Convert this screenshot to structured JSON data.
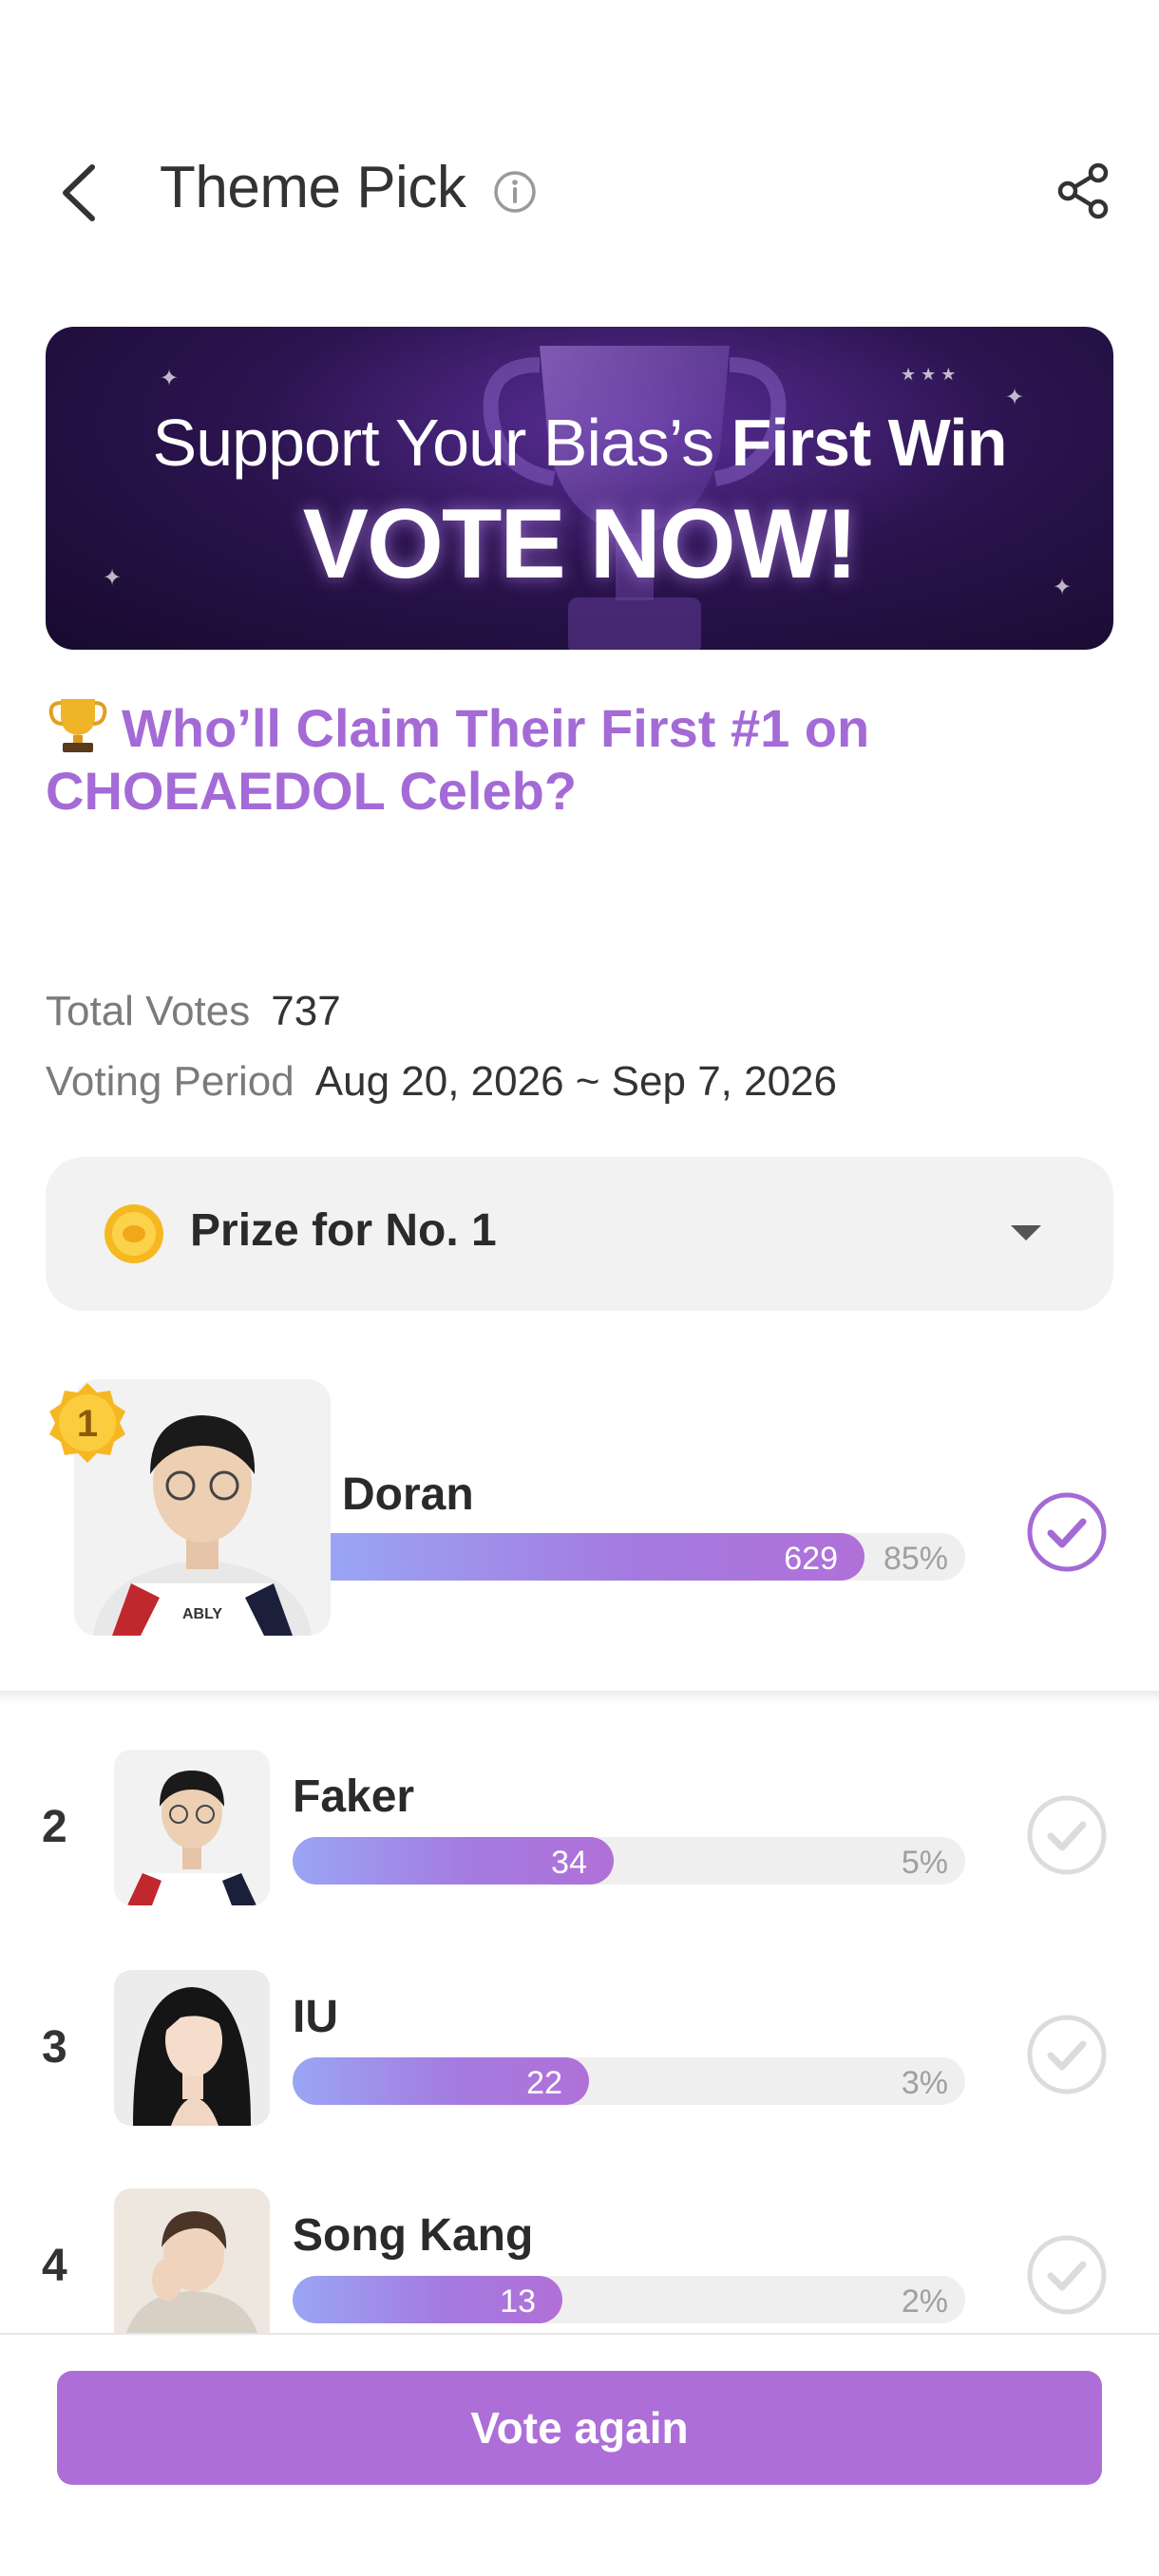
{
  "header": {
    "title": "Theme Pick",
    "back_icon": "chevron-left-icon",
    "info_icon": "info-icon",
    "share_icon": "share-icon"
  },
  "banner": {
    "line1_regular": "Support Your Bias’s",
    "line1_bold": "First Win",
    "line2": "VOTE NOW!"
  },
  "headline": {
    "text": "Who’ll Claim Their First #1 on CHOEAEDOL Celeb?",
    "icon": "trophy-icon",
    "color": "#a46ad6"
  },
  "meta": {
    "total_votes_label": "Total Votes",
    "total_votes_value": "737",
    "period_label": "Voting Period",
    "period_value": "Aug 20, 2026 ~ Sep 7, 2026"
  },
  "prize": {
    "label": "Prize for No. 1",
    "icon": "coin-icon"
  },
  "candidates": [
    {
      "rank": "1",
      "name": "Doran",
      "votes": "629",
      "percent": "85%",
      "fill": 0.85,
      "selected": true
    },
    {
      "rank": "2",
      "name": "Faker",
      "votes": "34",
      "percent": "5%",
      "fill": 0.48,
      "selected": false
    },
    {
      "rank": "3",
      "name": "IU",
      "votes": "22",
      "percent": "3%",
      "fill": 0.44,
      "selected": false
    },
    {
      "rank": "4",
      "name": "Song Kang",
      "votes": "13",
      "percent": "2%",
      "fill": 0.4,
      "selected": false
    }
  ],
  "footer": {
    "vote_button": "Vote again"
  },
  "colors": {
    "accent": "#ad6fd7",
    "bar_start": "#9aa5f5",
    "bar_end": "#b070d8"
  }
}
